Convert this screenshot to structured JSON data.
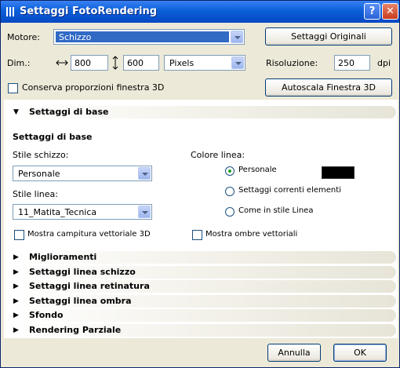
{
  "window": {
    "title": "Settaggi FotoRendering",
    "help": "?",
    "close": "✕"
  },
  "top": {
    "engine_label": "Motore:",
    "engine_value": "Schizzo",
    "original_settings_button": "Settaggi Originali",
    "dim_label": "Dim.:",
    "width": "800",
    "height": "600",
    "unit_value": "Pixels",
    "resolution_label": "Risoluzione:",
    "resolution_value": "250",
    "resolution_unit": "dpi",
    "keep_proportions_label": "Conserva proporzioni finestra 3D",
    "keep_proportions_checked": false,
    "autoscale_button": "Autoscala Finestra 3D"
  },
  "basic": {
    "section_title": "Settaggi di base",
    "group_title": "Settaggi di base",
    "sketch_style_label": "Stile schizzo:",
    "sketch_style_value": "Personale",
    "line_style_label": "Stile linea:",
    "line_style_value": "11_Matita_Tecnica",
    "line_color_label": "Colore linea:",
    "line_color_options": [
      "Personale",
      "Settaggi correnti elementi",
      "Come in stile Linea"
    ],
    "line_color_selected": 0,
    "line_color_swatch": "#000000",
    "show_vector_hatch_label": "Mostra campitura vettoriale 3D",
    "show_vector_shadows_label": "Mostra ombre vettoriali"
  },
  "sections": [
    {
      "label": "Miglioramenti"
    },
    {
      "label": "Settaggi linea schizzo"
    },
    {
      "label": "Settaggi linea retinatura"
    },
    {
      "label": "Settaggi linea ombra"
    },
    {
      "label": "Sfondo"
    },
    {
      "label": "Rendering Parziale"
    }
  ],
  "footer": {
    "cancel_button": "Annulla",
    "ok_button": "OK"
  },
  "colors": {
    "titlebar": "#0a5fd8",
    "selection": "#316ac5",
    "dialog_bg": "#ece9d8"
  }
}
